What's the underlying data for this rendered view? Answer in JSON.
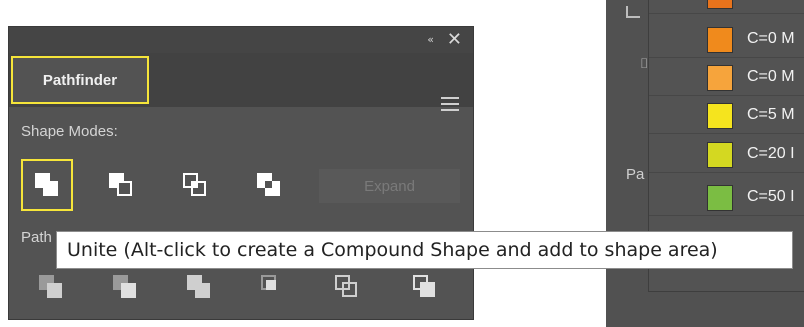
{
  "panel": {
    "title": "Pathfinder",
    "collapse_glyph": "«",
    "close_glyph": "✕",
    "menu_icon": "hamburger-menu-icon",
    "shape_modes_label": "Shape Modes:",
    "shape_mode_icons": [
      "unite-icon",
      "minus-front-icon",
      "intersect-icon",
      "exclude-icon"
    ],
    "expand_label": "Expand",
    "pathfinders_label": "Path",
    "pathfinder_icons": [
      "divide-icon",
      "trim-icon",
      "merge-icon",
      "crop-icon",
      "outline-icon",
      "minus-back-icon"
    ]
  },
  "tooltip": {
    "text": "Unite (Alt-click to create a Compound Shape and add to shape area)"
  },
  "right_panel": {
    "side_label": "Pa",
    "swatches": [
      {
        "label": "C=0 M",
        "color": "#f08a1c"
      },
      {
        "label": "C=0 M",
        "color": "#f6a43c"
      },
      {
        "label": "C=5 M",
        "color": "#f5e41e"
      },
      {
        "label": "C=20 I",
        "color": "#d4d821"
      },
      {
        "label": "C=50 I",
        "color": "#7bbd43"
      }
    ]
  },
  "colors": {
    "highlight": "#f6e53a",
    "panel_bg": "#535353"
  }
}
